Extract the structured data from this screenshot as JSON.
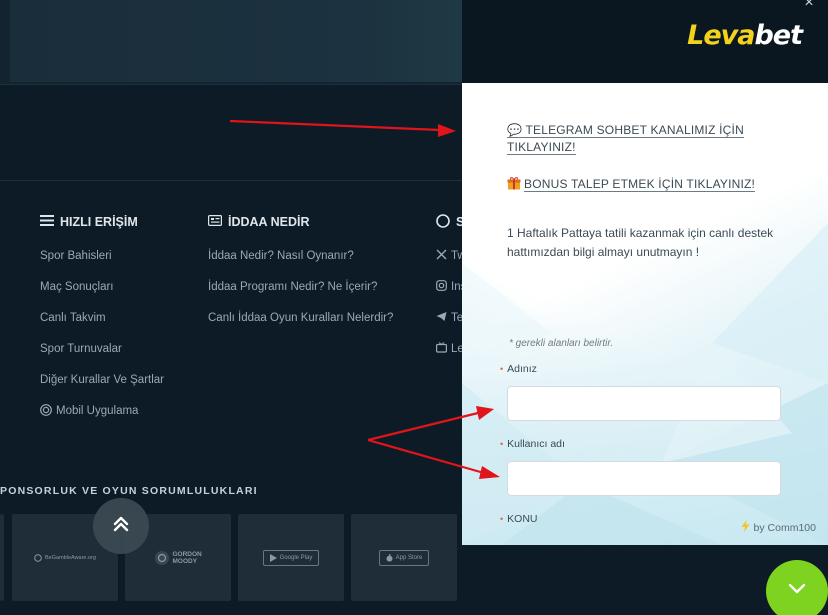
{
  "footer": {
    "quick_access": {
      "title": "HIZLI ERİŞİM",
      "items": [
        "Spor Bahisleri",
        "Maç Sonuçları",
        "Canlı Takvim",
        "Spor Turnuvalar",
        "Diğer Kurallar Ve Şartlar",
        "Mobil Uygulama"
      ]
    },
    "iddaa": {
      "title": "İDDAA NEDİR",
      "items": [
        "İddaa Nedir? Nasıl Oynanır?",
        "İddaa Programı Nedir? Ne İçerir?",
        "Canlı İddaa Oyun Kuralları Nelerdir?"
      ]
    },
    "social": {
      "title": "S",
      "items": [
        "Tw",
        "Ins",
        "Te",
        "Lev"
      ]
    },
    "sponsorship": {
      "title": "PONSORLUK VE OYUN SORUMLULUKLARI",
      "logos": [
        "BeGambleAware.org",
        "GORDON MOODY",
        "Google Play",
        "App Store"
      ]
    }
  },
  "widget": {
    "brand_part1": "Leva",
    "brand_part2": "bet",
    "close_glyph": "×",
    "telegram_link": "💬 TELEGRAM SOHBET KANALIMIZ İÇİN TIKLAYINIZ!",
    "bonus_link": "BONUS TALEP ETMEK İÇİN TIKLAYINIZ!",
    "promo_text": "1 Haftalık Pattaya tatili kazanmak için canlı destek hattımızdan bilgi almayı unutmayın !",
    "required_note": "* gerekli alanları belirtir.",
    "fields": [
      {
        "label": "Adınız",
        "value": ""
      },
      {
        "label": "Kullanıcı adı",
        "value": ""
      },
      {
        "label": "KONU",
        "value": ""
      }
    ],
    "powered_by": "by Comm100"
  },
  "icons": {
    "menu": "menu-icon",
    "ticket": "ticket-icon",
    "circle": "circle-icon",
    "gift": "gift-icon",
    "scroll_up": "double-chevron-up-icon",
    "chat_toggle": "chevron-down-icon"
  },
  "colors": {
    "page_bg": "#0d1b26",
    "widget_header_bg": "#0b1720",
    "brand_yellow": "#f3d21c",
    "fab_green": "#7ed321",
    "arrow_red": "#e0141b"
  }
}
